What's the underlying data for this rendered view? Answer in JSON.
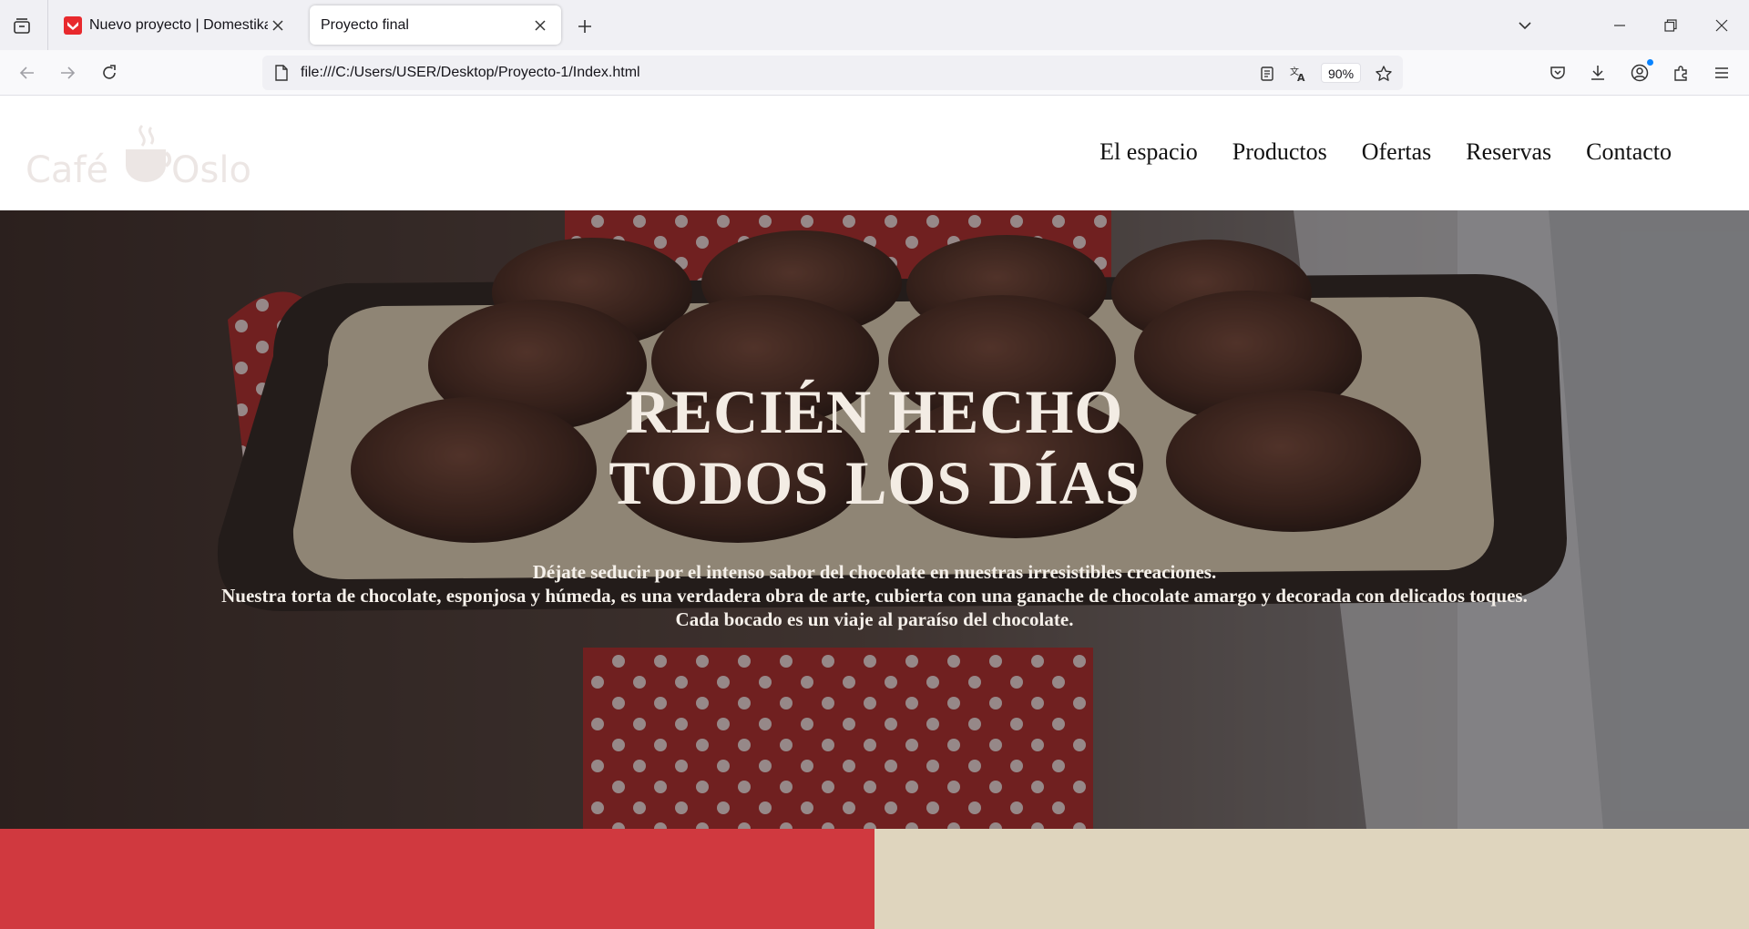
{
  "browser": {
    "tabs": [
      {
        "title": "Nuevo proyecto | Domestika",
        "active": false,
        "favicon": "domestika-icon"
      },
      {
        "title": "Proyecto final",
        "active": true
      }
    ],
    "url": "file:///C:/Users/USER/Desktop/Proyecto-1/Index.html",
    "zoom": "90%",
    "colors": {
      "tabbar": "#f0f0f4",
      "toolbar": "#f9f9fb",
      "accent": "#0a84ff"
    }
  },
  "site": {
    "logo": {
      "left": "Café",
      "right": "Oslo"
    },
    "nav": [
      "El espacio",
      "Productos",
      "Ofertas",
      "Reservas",
      "Contacto"
    ],
    "hero": {
      "title_line1": "RECIÉN HECHO",
      "title_line2": "TODOS LOS DÍAS",
      "text_line1": "Déjate seducir por el intenso sabor del chocolate en nuestras irresistibles creaciones.",
      "text_line2": "Nuestra torta de chocolate, esponjosa y húmeda, es una verdadera obra de arte, cubierta con una ganache de chocolate amargo y decorada con delicados toques.",
      "text_line3": "Cada bocado es un viaje al paraíso del chocolate."
    },
    "colors": {
      "red_block": "#d0393f",
      "beige_block": "#dfd5be",
      "hero_text": "#f3ece4"
    }
  }
}
